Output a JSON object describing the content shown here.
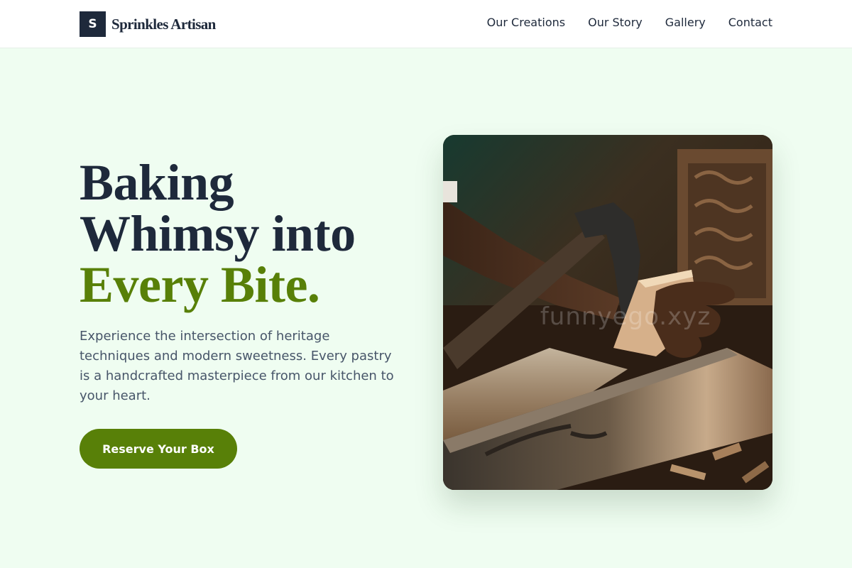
{
  "brand": {
    "logo_letter": "S",
    "name": "Sprinkles Artisan"
  },
  "nav": {
    "items": [
      "Our Creations",
      "Our Story",
      "Gallery",
      "Contact"
    ]
  },
  "hero": {
    "title_line1": "Baking",
    "title_line2": "Whimsy into",
    "title_line3": "Every Bite.",
    "description": "Experience the intersection of heritage techniques and modern sweetness. Every pastry is a handcrafted masterpiece from our kitchen to your heart.",
    "cta_label": "Reserve Your Box",
    "image_watermark": "funnyego.xyz",
    "image_alt": "Craftsman carving wood with an adze"
  },
  "colors": {
    "accent": "#588008",
    "dark": "#1e293b",
    "background": "#effdf1",
    "body_text": "#475569"
  }
}
